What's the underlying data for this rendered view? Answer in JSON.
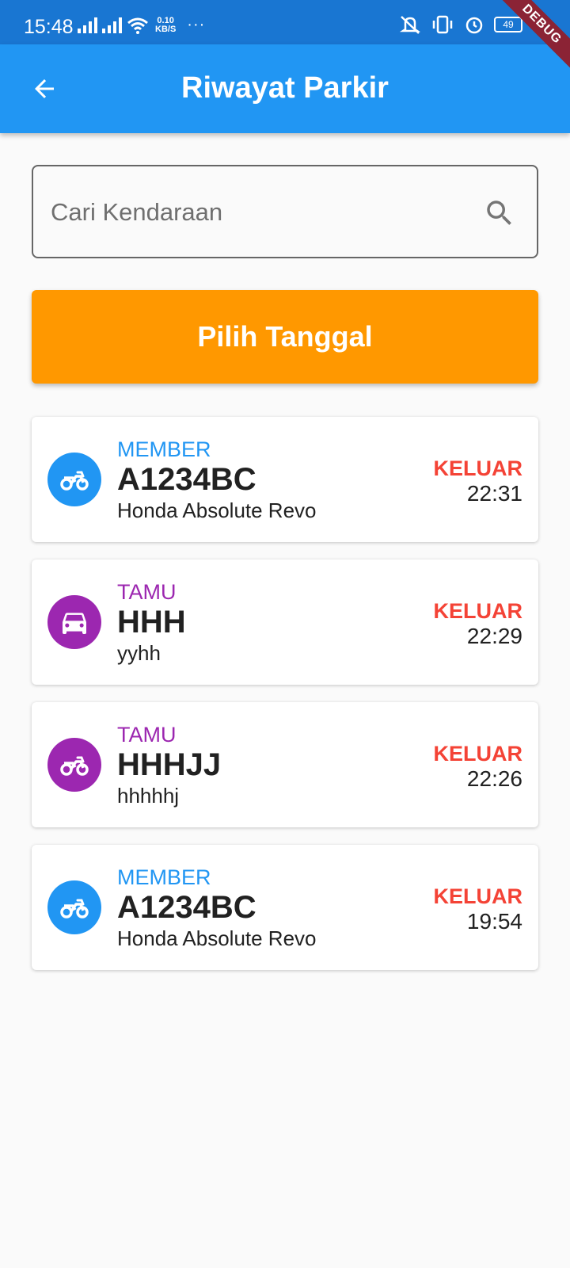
{
  "status_bar": {
    "time": "15:48",
    "net_speed_value": "0.10",
    "net_speed_unit": "KB/S",
    "more": "···",
    "battery": "49"
  },
  "debug_banner": "DEBUG",
  "app_bar": {
    "title": "Riwayat Parkir",
    "back_icon": "arrow-back-icon",
    "color": "#2196f3"
  },
  "search": {
    "placeholder": "Cari Kendaraan",
    "value": "",
    "icon": "search-icon"
  },
  "date_button": {
    "label": "Pilih Tanggal",
    "color": "#ff9800"
  },
  "colors": {
    "member": "#2196f3",
    "tamu": "#9c27b0",
    "status_out": "#f44336"
  },
  "history": [
    {
      "category": "MEMBER",
      "plate": "A1234BC",
      "model": "Honda Absolute Revo",
      "status": "KELUAR",
      "time": "22:31",
      "vehicle_icon": "motorcycle-icon",
      "color": "#2196f3"
    },
    {
      "category": "TAMU",
      "plate": "HHH",
      "model": "yyhh",
      "status": "KELUAR",
      "time": "22:29",
      "vehicle_icon": "car-icon",
      "color": "#9c27b0"
    },
    {
      "category": "TAMU",
      "plate": "HHHJJ",
      "model": "hhhhhj",
      "status": "KELUAR",
      "time": "22:26",
      "vehicle_icon": "motorcycle-icon",
      "color": "#9c27b0"
    },
    {
      "category": "MEMBER",
      "plate": "A1234BC",
      "model": "Honda Absolute Revo",
      "status": "KELUAR",
      "time": "19:54",
      "vehicle_icon": "motorcycle-icon",
      "color": "#2196f3"
    }
  ]
}
